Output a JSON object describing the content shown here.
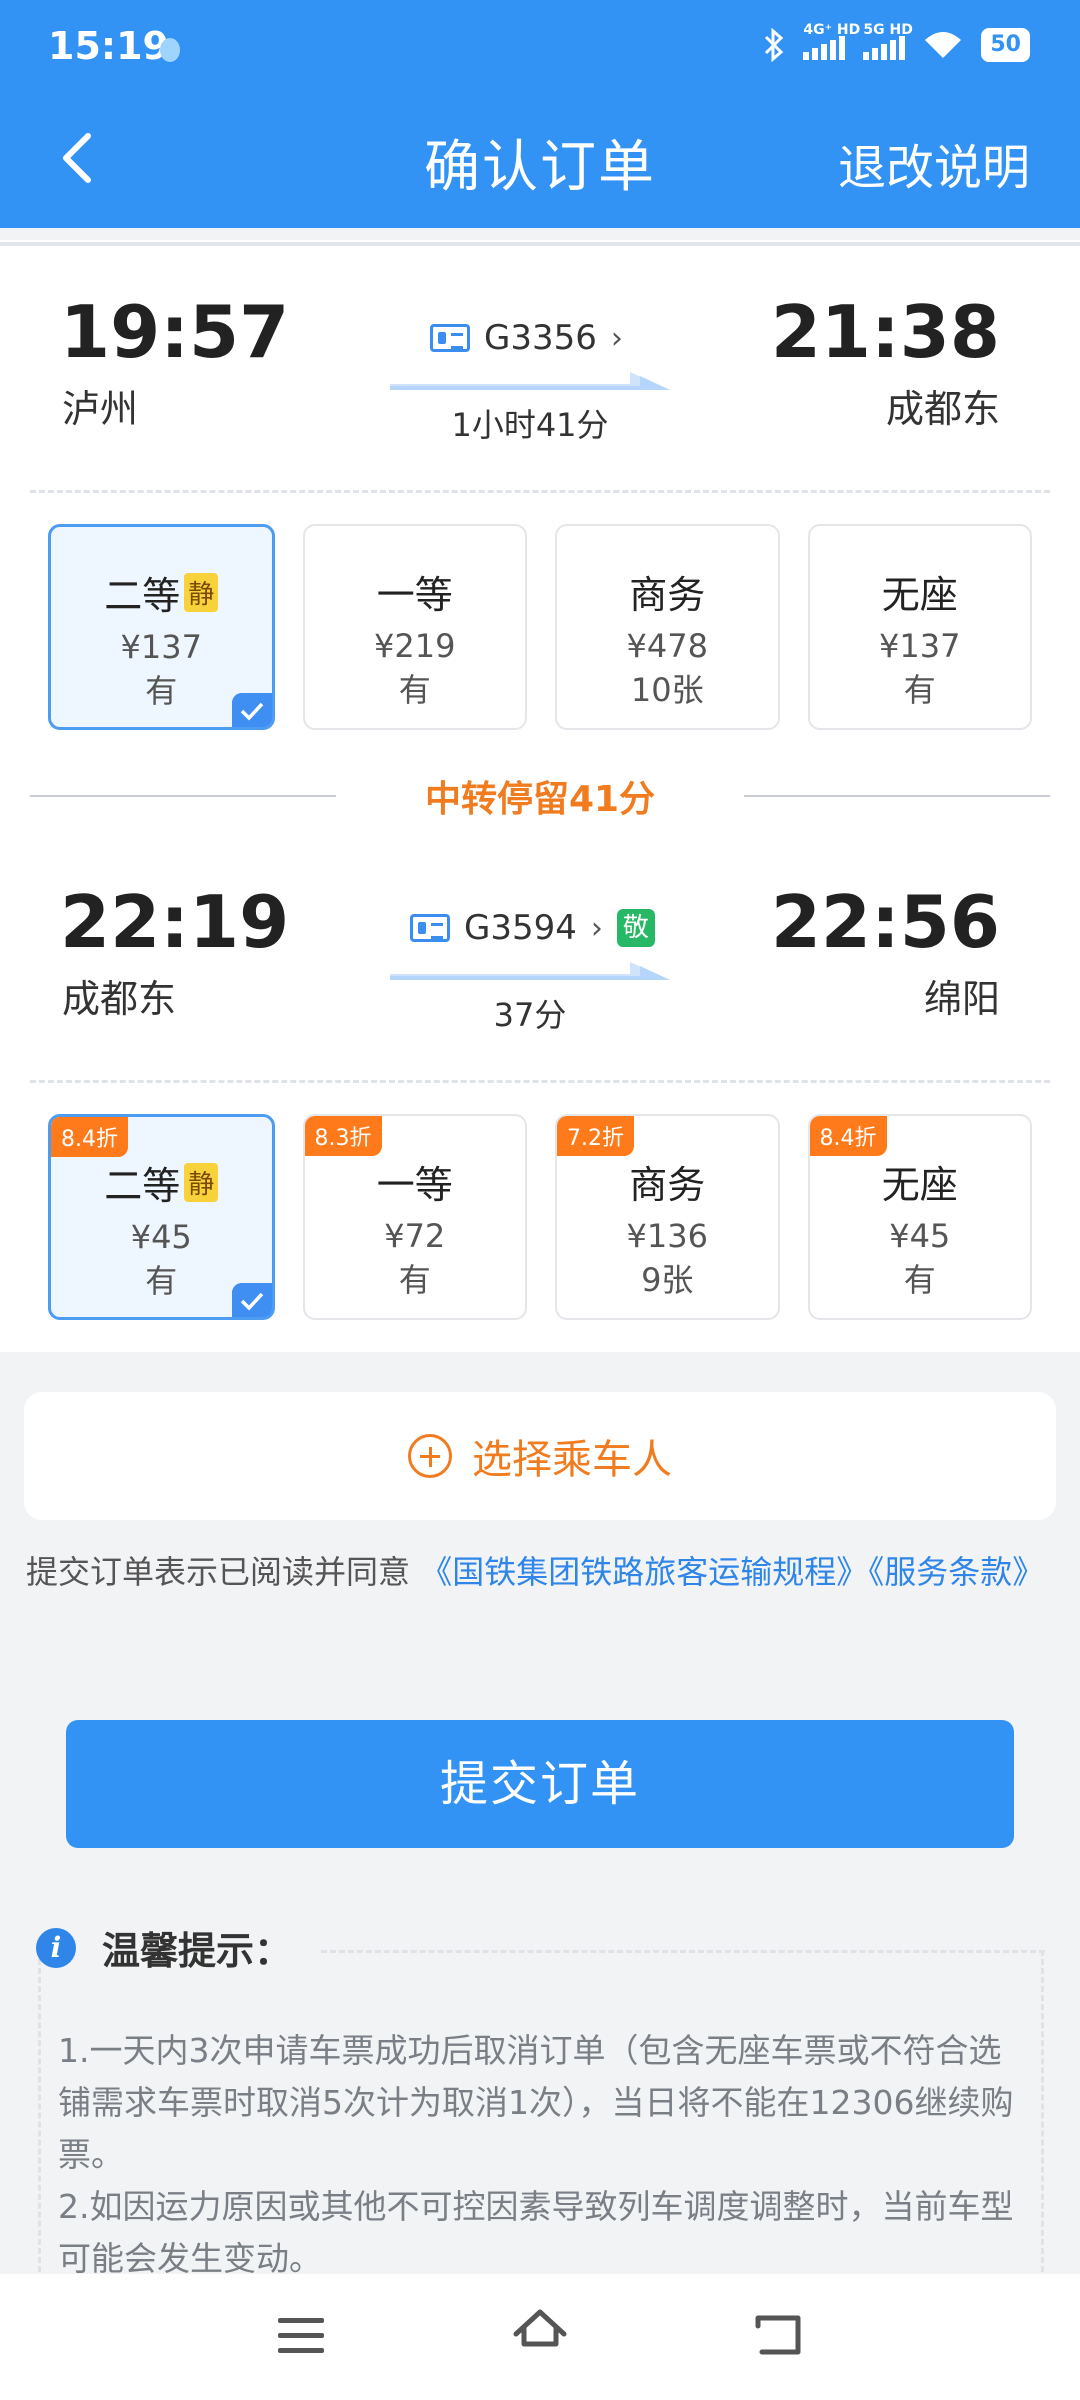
{
  "status": {
    "time": "15:19",
    "net1": "4G⁺ HD",
    "net2": "5G HD",
    "battery": "50"
  },
  "nav": {
    "title": "确认订单",
    "refund_label": "退改说明"
  },
  "leg1": {
    "dep_time": "19:57",
    "dep_station": "泸州",
    "arr_time": "21:38",
    "arr_station": "成都东",
    "train_no": "G3356",
    "duration": "1小时41分",
    "seats": [
      {
        "name": "二等",
        "tag": "静",
        "price": "¥137",
        "avail": "有",
        "selected": true
      },
      {
        "name": "一等",
        "price": "¥219",
        "avail": "有"
      },
      {
        "name": "商务",
        "price": "¥478",
        "avail": "10张"
      },
      {
        "name": "无座",
        "price": "¥137",
        "avail": "有"
      }
    ]
  },
  "transfer": {
    "text": "中转停留41分"
  },
  "leg2": {
    "dep_time": "22:19",
    "dep_station": "成都东",
    "arr_time": "22:56",
    "arr_station": "绵阳",
    "train_no": "G3594",
    "badge": "敬",
    "duration": "37分",
    "seats": [
      {
        "discount": "8.4折",
        "name": "二等",
        "tag": "静",
        "price": "¥45",
        "avail": "有",
        "selected": true
      },
      {
        "discount": "8.3折",
        "name": "一等",
        "price": "¥72",
        "avail": "有"
      },
      {
        "discount": "7.2折",
        "name": "商务",
        "price": "¥136",
        "avail": "9张"
      },
      {
        "discount": "8.4折",
        "name": "无座",
        "price": "¥45",
        "avail": "有"
      }
    ]
  },
  "passenger": {
    "label": "选择乘车人"
  },
  "agreement": {
    "prefix": "提交订单表示已阅读并同意",
    "link1": "《国铁集团铁路旅客运输规程》",
    "link2": "《服务条款》"
  },
  "submit": {
    "label": "提交订单"
  },
  "tips": {
    "title": "温馨提示：",
    "line1": "1.一天内3次申请车票成功后取消订单（包含无座车票或不符合选铺需求车票时取消5次计为取消1次），当日将不能在12306继续购票。",
    "line2": "2.如因运力原因或其他不可控因素导致列车调度调整时，当前车型可能会发生变动。"
  },
  "colors": {
    "primary": "#3293f5",
    "accent": "#f07c1f",
    "discount": "#ff7a1a",
    "green_badge": "#27b865"
  }
}
